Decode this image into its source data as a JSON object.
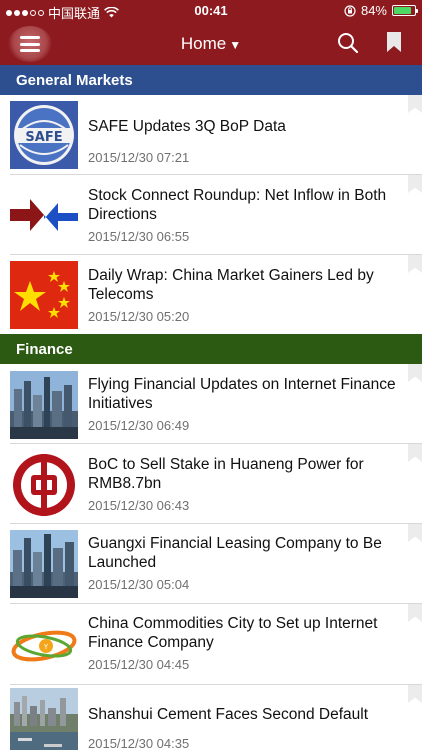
{
  "status_bar": {
    "carrier": "中国联通",
    "time": "00:41",
    "battery_percent": "84%",
    "battery_level": 0.84,
    "signal_dots_filled": 3
  },
  "nav": {
    "title": "Home",
    "caret": "▼",
    "menu_icon": "hamburger-menu-icon",
    "search_icon": "search-icon",
    "bookmark_icon": "bookmark-icon"
  },
  "colors": {
    "nav_bg": "#8c1a1e",
    "general_markets_bg": "#2d4f8f",
    "finance_bg": "#2d5a12",
    "date_text": "#707070"
  },
  "sections": [
    {
      "title": "General Markets",
      "articles": [
        {
          "headline": "SAFE Updates 3Q BoP Data",
          "date": "2015/12/30 07:21",
          "thumb": "safe-logo"
        },
        {
          "headline": "Stock Connect Roundup: Net Inflow in Both Directions",
          "date": "2015/12/30 06:55",
          "thumb": "flow-arrows"
        },
        {
          "headline": "Daily Wrap: China Market Gainers Led by Telecoms",
          "date": "2015/12/30 05:20",
          "thumb": "china-flag"
        }
      ]
    },
    {
      "title": "Finance",
      "articles": [
        {
          "headline": "Flying Financial Updates on Internet Finance Initiatives",
          "date": "2015/12/30 06:49",
          "thumb": "city-skyline"
        },
        {
          "headline": "BoC to Sell Stake in Huaneng Power for RMB8.7bn",
          "date": "2015/12/30 06:43",
          "thumb": "boc-logo"
        },
        {
          "headline": "Guangxi Financial Leasing Company to Be Launched",
          "date": "2015/12/30 05:04",
          "thumb": "city-skyline"
        },
        {
          "headline": "China Commodities City to Set up Internet Finance Company",
          "date": "2015/12/30 04:45",
          "thumb": "orbit-logo"
        },
        {
          "headline": "Shanshui Cement Faces Second Default",
          "date": "2015/12/30 04:35",
          "thumb": "harbor-photo"
        }
      ]
    }
  ]
}
